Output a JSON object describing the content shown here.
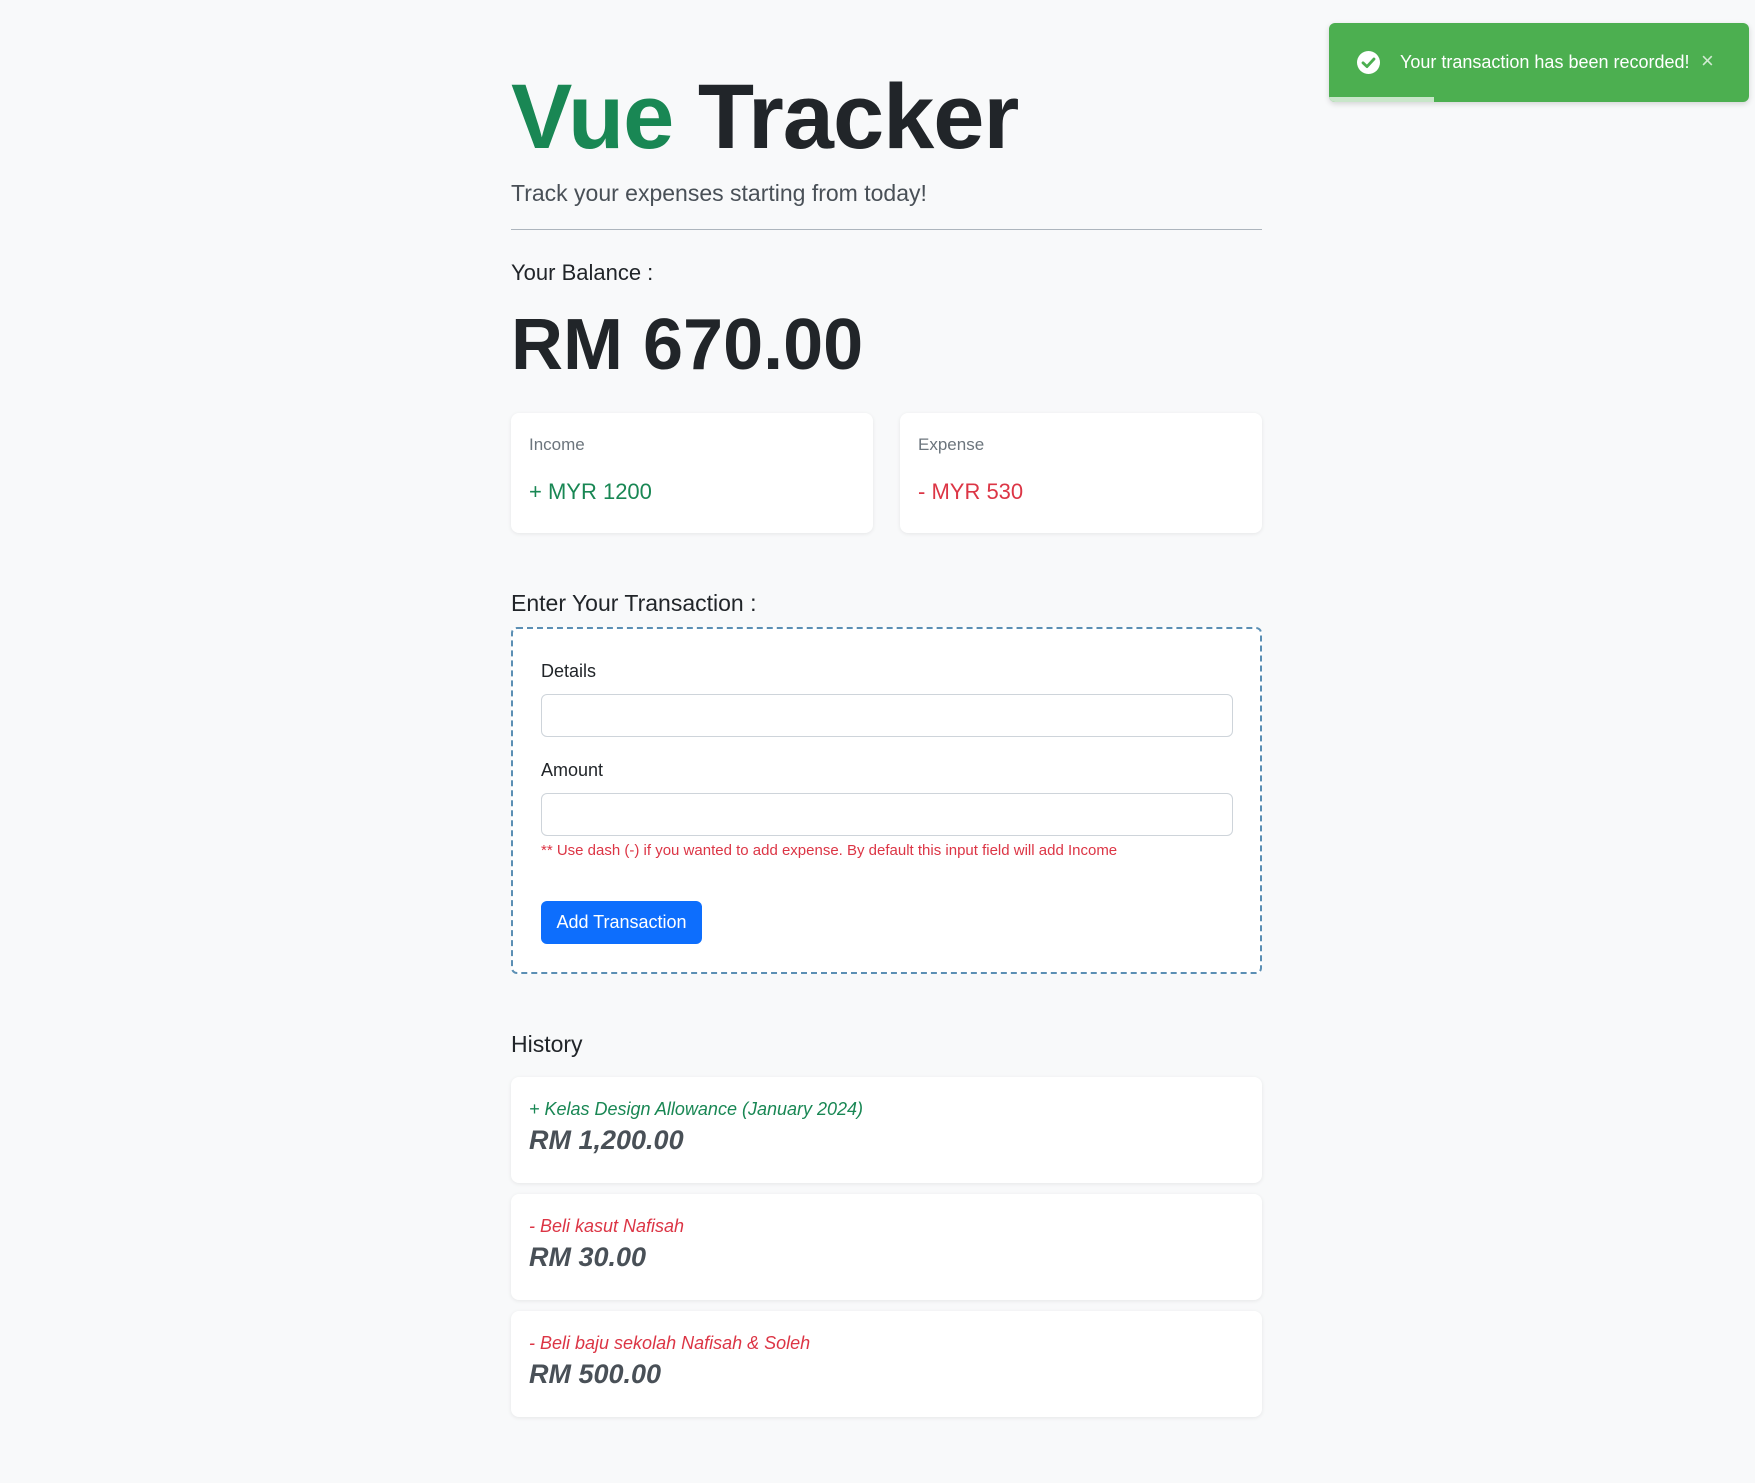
{
  "app": {
    "title_part1": "Vue",
    "title_part2": "Tracker",
    "subtitle": "Track your expenses starting from today!"
  },
  "toast": {
    "message": "Your transaction has been recorded!",
    "close_label": "×",
    "icon": "check-circle-icon",
    "color": "#4caf50",
    "progress": 0.25
  },
  "balance": {
    "label": "Your Balance :",
    "value": "RM 670.00"
  },
  "summary": {
    "income_label": "Income",
    "income_value": "+ MYR 1200",
    "expense_label": "Expense",
    "expense_value": "- MYR 530"
  },
  "form": {
    "heading": "Enter Your Transaction :",
    "details_label": "Details",
    "details_value": "",
    "amount_label": "Amount",
    "amount_value": "",
    "hint": "** Use dash (-) if you wanted to add expense. By default this input field will add Income",
    "submit_label": "Add Transaction"
  },
  "history": {
    "heading": "History",
    "items": [
      {
        "name": "+ Kelas Design Allowance (January 2024)",
        "amount": "RM 1,200.00",
        "type": "income"
      },
      {
        "name": "- Beli kasut Nafisah",
        "amount": "RM 30.00",
        "type": "expense"
      },
      {
        "name": "- Beli baju sekolah Nafisah & Soleh",
        "amount": "RM 500.00",
        "type": "expense"
      }
    ]
  },
  "colors": {
    "income": "#198754",
    "expense": "#dc3545",
    "primary": "#0d6efd"
  }
}
